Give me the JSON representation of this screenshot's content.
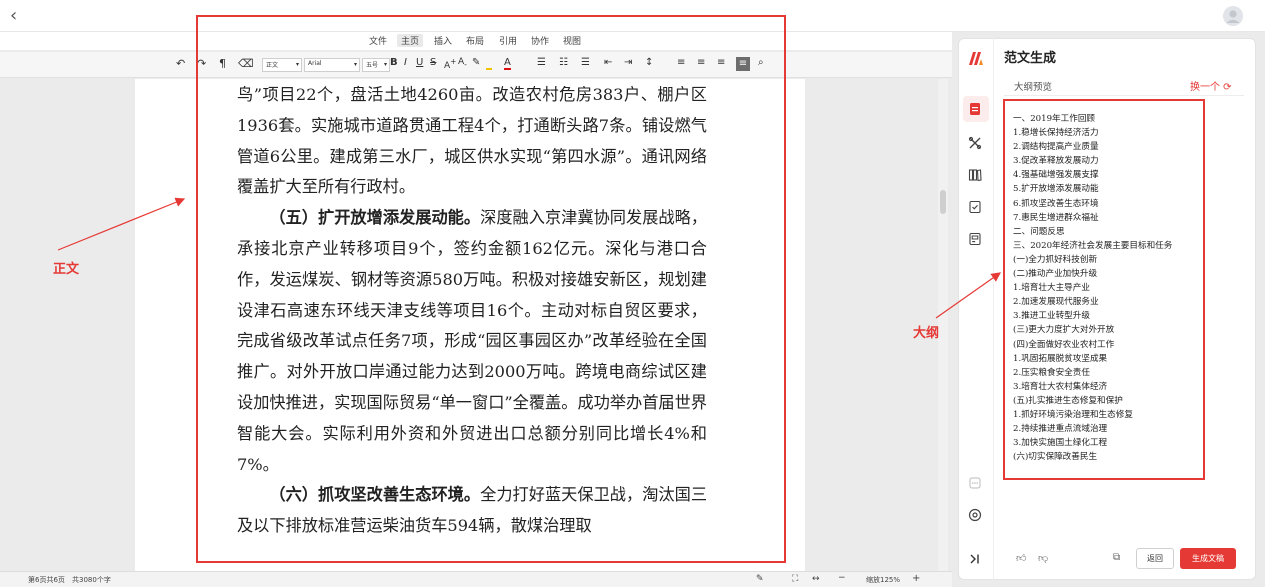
{
  "menu": {
    "items": [
      "文件",
      "主页",
      "插入",
      "布局",
      "引用",
      "协作",
      "视图"
    ],
    "active": "主页"
  },
  "toolbar": {
    "style_value": "正文",
    "font_value": "Arial",
    "size_value": "五号"
  },
  "document": {
    "paragraphs": [
      {
        "type": "cont",
        "text": "鸟”项目22个，盘活土地4260亩。改造农村危房383户、棚户区1936套。实施城市道路贯通工程4个，打通断头路7条。铺设燃气管道6公里。建成第三水厂，城区供水实现“第四水源”。通讯网络覆盖扩大至所有行政村。"
      },
      {
        "type": "head",
        "heading": "（五）扩开放增添发展动能。",
        "text": "深度融入京津冀协同发展战略，承接北京产业转移项目9个，签约金额162亿元。深化与港口合作，发运煤炭、钢材等资源580万吨。积极对接雄安新区，规划建设津石高速东环线天津支线等项目16个。主动对标自贸区要求，完成省级改革试点任务7项，形成“园区事园区办”改革经验在全国推广。对外开放口岸通过能力达到2000万吨。跨境电商综试区建设加快推进，实现国际贸易“单一窗口”全覆盖。成功举办首届世界智能大会。实际利用外资和外贸进出口总额分别同比增长4%和7%。"
      },
      {
        "type": "head",
        "heading": "（六）抓攻坚改善生态环境。",
        "text": "全力打好蓝天保卫战，淘汰国三及以下排放标准营运柴油货车594辆，散煤治理取"
      }
    ]
  },
  "status": {
    "pages": "第6页共6页",
    "words": "共3080个字",
    "zoom": "缩放125%"
  },
  "annotations": {
    "body_label": "正文",
    "outline_label": "大纲"
  },
  "panel": {
    "title": "范文生成",
    "outline_preview_label": "大纲预览",
    "refresh_label": "换一个",
    "outline": [
      "一、2019年工作回顾",
      "1.稳增长保持经济活力",
      "2.调结构提高产业质量",
      "3.促改革释放发展动力",
      "4.强基础增强发展支撑",
      "5.扩开放增添发展动能",
      "6.抓攻坚改善生态环境",
      "7.惠民生增进群众福祉",
      "二、问题反思",
      "三、2020年经济社会发展主要目标和任务",
      "(一)全力抓好科技创新",
      "(二)推动产业加快升级",
      "1.培育壮大主导产业",
      "2.加速发展现代服务业",
      "3.推进工业转型升级",
      "(三)更大力度扩大对外开放",
      "(四)全面做好农业农村工作",
      "1.巩固拓展脱贫攻坚成果",
      "2.压实粮食安全责任",
      "3.培育壮大农村集体经济",
      "(五)扎实推进生态修复和保护",
      "1.抓好环境污染治理和生态修复",
      "2.持续推进重点流域治理",
      "3.加快实施国土绿化工程",
      "(六)切实保障改善民生"
    ],
    "back_label": "返回",
    "generate_label": "生成文稿"
  }
}
